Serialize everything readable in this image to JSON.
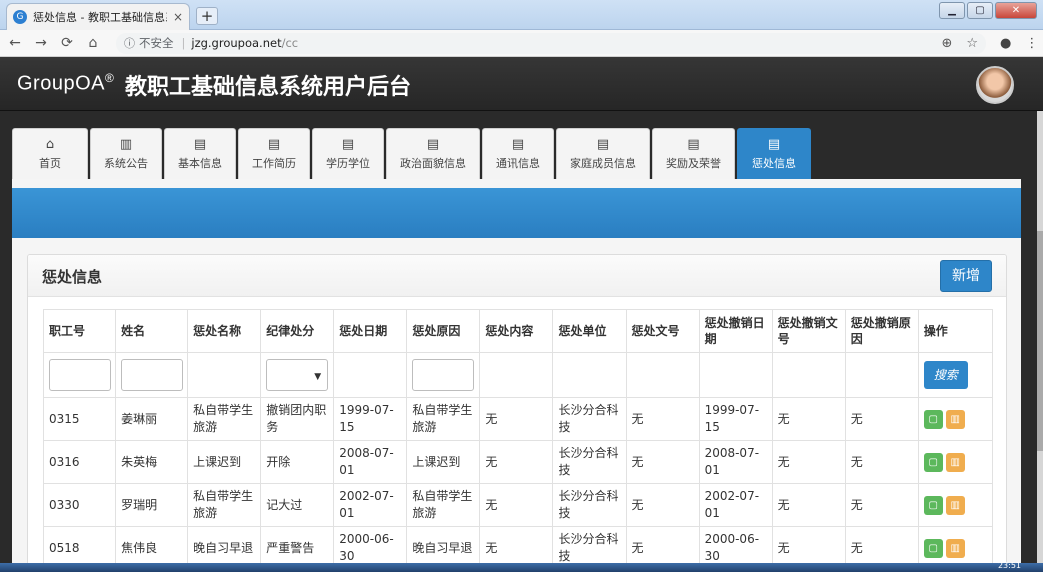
{
  "browser": {
    "tab_title": "惩处信息 - 教职工基础信息系统",
    "tab_favicon": "G",
    "tab_close": "×",
    "new_tab": "+",
    "window_buttons": [
      "▁",
      "▢",
      "✕"
    ],
    "nav_icons": [
      "←",
      "→",
      "⟳",
      "⌂"
    ],
    "url_info_icon": "ⓘ",
    "url_security": "不安全",
    "url_host": "jzg.groupoa.net",
    "url_path": "/cc",
    "url_actions": [
      "⊕",
      "☆"
    ],
    "toolbar_actions": [
      "●",
      "⋮"
    ]
  },
  "app": {
    "brand": "GroupOA",
    "brand_mark": "®",
    "title": "教职工基础信息系统用户后台"
  },
  "nav": {
    "tabs": [
      {
        "label": "首页",
        "icon": "home-icon",
        "glyph": "⌂"
      },
      {
        "label": "系统公告",
        "icon": "bar-chart-icon",
        "glyph": "▥"
      },
      {
        "label": "基本信息",
        "icon": "book-icon",
        "glyph": "▤"
      },
      {
        "label": "工作简历",
        "icon": "book-icon",
        "glyph": "▤"
      },
      {
        "label": "学历学位",
        "icon": "book-icon",
        "glyph": "▤"
      },
      {
        "label": "政治面貌信息",
        "icon": "book-icon",
        "glyph": "▤"
      },
      {
        "label": "通讯信息",
        "icon": "book-icon",
        "glyph": "▤"
      },
      {
        "label": "家庭成员信息",
        "icon": "book-icon",
        "glyph": "▤"
      },
      {
        "label": "奖励及荣誉",
        "icon": "book-icon",
        "glyph": "▤"
      },
      {
        "label": "惩处信息",
        "icon": "book-icon",
        "glyph": "▤",
        "active": true
      }
    ]
  },
  "panel": {
    "title": "惩处信息",
    "add_label": "新增",
    "search_label": "搜索",
    "select_caret": "▼",
    "edit_glyph": "▢",
    "delete_glyph": "▥",
    "columns": [
      "职工号",
      "姓名",
      "惩处名称",
      "纪律处分",
      "惩处日期",
      "惩处原因",
      "惩处内容",
      "惩处单位",
      "惩处文号",
      "惩处撤销日期",
      "惩处撤销文号",
      "惩处撤销原因",
      "操作"
    ],
    "rows": [
      [
        "0315",
        "姜琳丽",
        "私自带学生旅游",
        "撤销团内职务",
        "1999-07-15",
        "私自带学生旅游",
        "无",
        "长沙分合科技",
        "无",
        "1999-07-15",
        "无",
        "无"
      ],
      [
        "0316",
        "朱英梅",
        "上课迟到",
        "开除",
        "2008-07-01",
        "上课迟到",
        "无",
        "长沙分合科技",
        "无",
        "2008-07-01",
        "无",
        "无"
      ],
      [
        "0330",
        "罗瑞明",
        "私自带学生旅游",
        "记大过",
        "2002-07-01",
        "私自带学生旅游",
        "无",
        "长沙分合科技",
        "无",
        "2002-07-01",
        "无",
        "无"
      ],
      [
        "0518",
        "焦伟良",
        "晚自习早退",
        "严重警告",
        "2000-06-30",
        "晚自习早退",
        "无",
        "长沙分合科技",
        "无",
        "2000-06-30",
        "无",
        "无"
      ]
    ]
  },
  "system": {
    "clock": "23:51"
  }
}
